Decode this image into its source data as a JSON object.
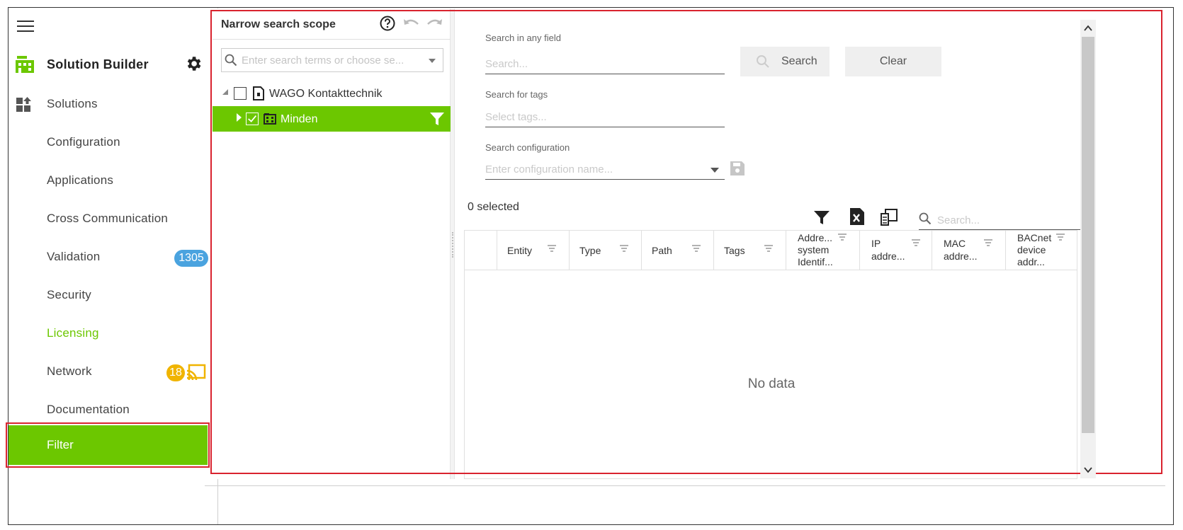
{
  "sidebar": {
    "brand_label": "Solution Builder",
    "items": [
      {
        "label": "Solutions"
      },
      {
        "label": "Configuration"
      },
      {
        "label": "Applications"
      },
      {
        "label": "Cross Communication"
      },
      {
        "label": "Validation",
        "badge": "1305"
      },
      {
        "label": "Security"
      },
      {
        "label": "Licensing"
      },
      {
        "label": "Network",
        "badge": "18"
      },
      {
        "label": "Documentation"
      },
      {
        "label": "Filter"
      }
    ],
    "colors": {
      "active": "#6cc700",
      "badge_blue": "#4aa3df",
      "badge_yellow": "#f0b400",
      "highlight": "#d9232e"
    }
  },
  "tree": {
    "title": "Narrow search scope",
    "search_placeholder": "Enter search terms or choose se...",
    "nodes": [
      {
        "label": "WAGO Kontakttechnik",
        "checked": false,
        "expanded": true
      },
      {
        "label": "Minden",
        "checked": true,
        "selected": true
      }
    ]
  },
  "search": {
    "any_field_label": "Search in any field",
    "any_field_placeholder": "Search...",
    "search_button": "Search",
    "clear_button": "Clear",
    "tags_label": "Search for tags",
    "tags_placeholder": "Select tags...",
    "config_label": "Search configuration",
    "config_placeholder": "Enter configuration name..."
  },
  "grid": {
    "selected_text": "0 selected",
    "search_placeholder": "Search...",
    "columns": [
      {
        "label": "Entity"
      },
      {
        "label": "Type"
      },
      {
        "label": "Path"
      },
      {
        "label": "Tags"
      },
      {
        "line1": "Addre...",
        "line2": "system",
        "line3": "Identif..."
      },
      {
        "line1": "IP",
        "line2": "addre..."
      },
      {
        "line1": "MAC",
        "line2": "addre..."
      },
      {
        "line1": "BACnet",
        "line2": "device",
        "line3": "addr..."
      }
    ],
    "empty_text": "No data"
  }
}
